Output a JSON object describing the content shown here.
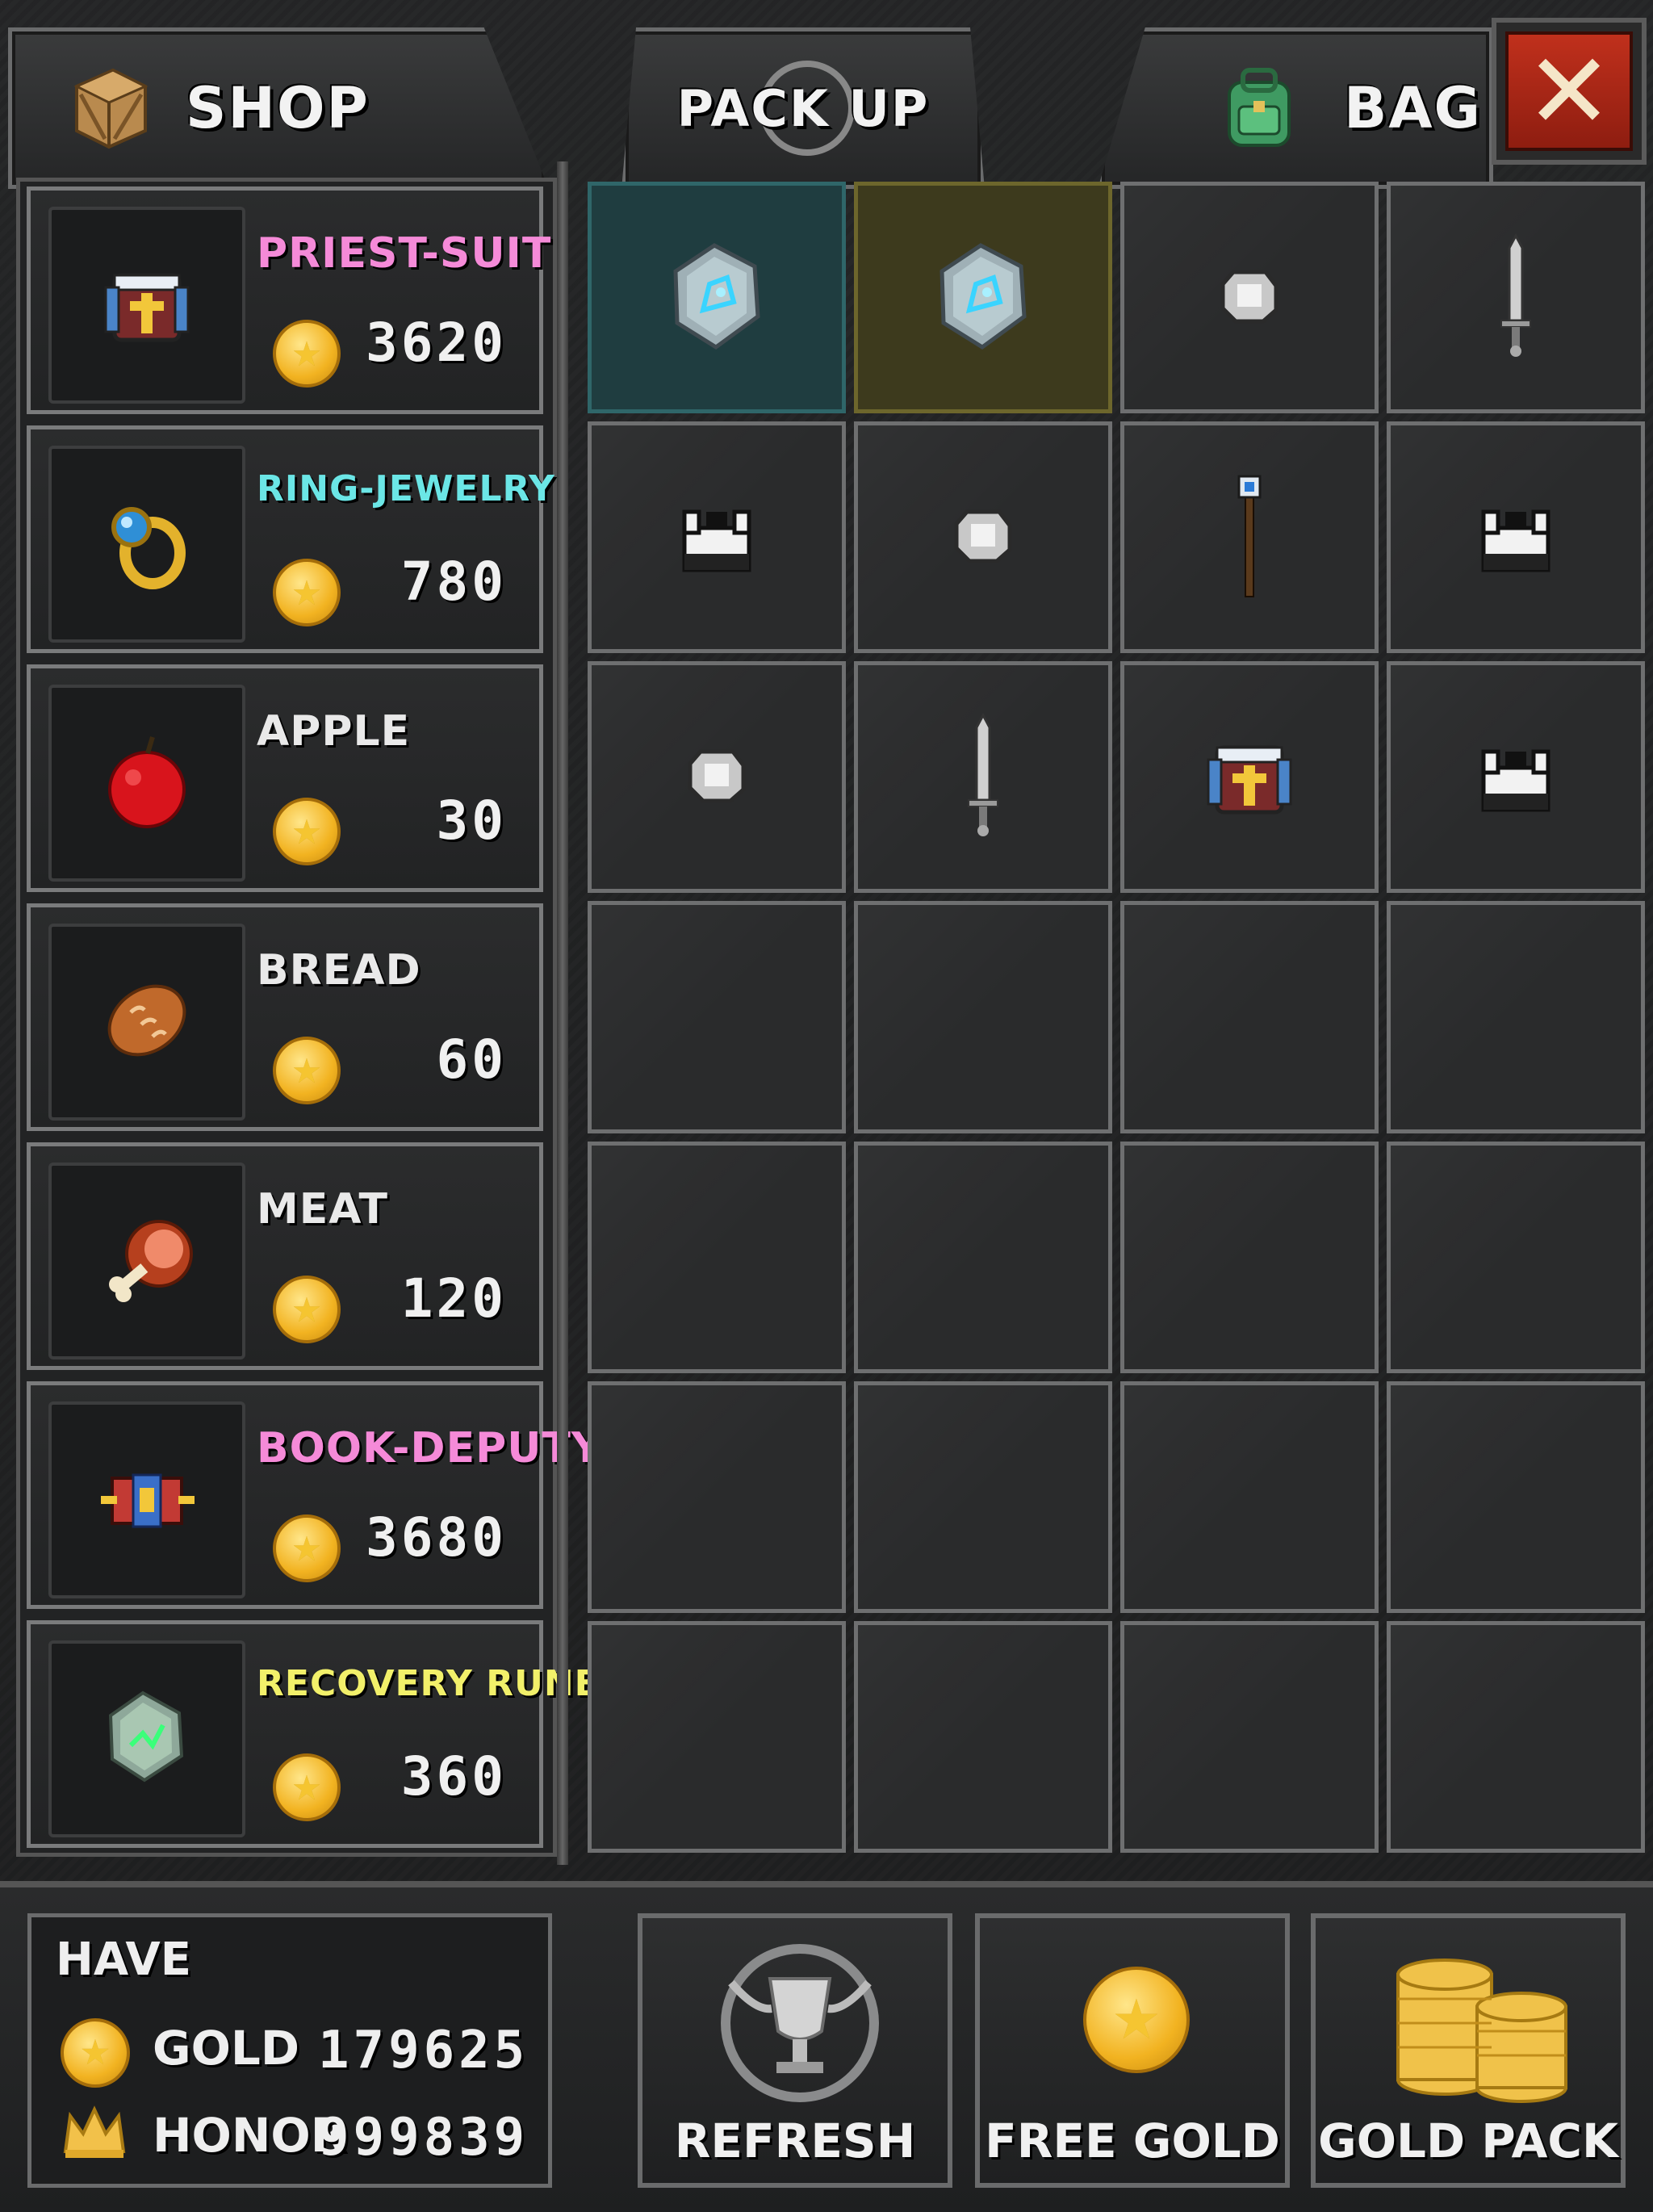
{
  "tabs": {
    "shop": "SHOP",
    "pack_up": "PACK UP",
    "bag": "BAG",
    "close": "✕"
  },
  "shop_items": [
    {
      "name": "PRIEST-SUIT",
      "price": "3620",
      "color": "#f58ad8",
      "icon": "priest-suit-icon"
    },
    {
      "name": "RING-JEWELRY",
      "price": "780",
      "color": "#6be6e6",
      "icon": "ring-icon"
    },
    {
      "name": "APPLE",
      "price": "30",
      "color": "#e9e9e9",
      "icon": "apple-icon"
    },
    {
      "name": "BREAD",
      "price": "60",
      "color": "#e9e9e9",
      "icon": "bread-icon"
    },
    {
      "name": "MEAT",
      "price": "120",
      "color": "#e9e9e9",
      "icon": "meat-icon"
    },
    {
      "name": "BOOK-DEPUTY",
      "price": "3680",
      "color": "#f58ad8",
      "icon": "book-icon"
    },
    {
      "name": "RECOVERY RUNE",
      "price": "360",
      "color": "#f2f06a",
      "icon": "recovery-rune-icon"
    }
  ],
  "bag_slots": [
    {
      "icon": "blue-rune-icon",
      "highlight": "teal"
    },
    {
      "icon": "blue-rune-icon",
      "highlight": "yellow"
    },
    {
      "icon": "silver-ore-icon"
    },
    {
      "icon": "sword-icon"
    },
    {
      "icon": "armor-icon"
    },
    {
      "icon": "silver-ore-icon"
    },
    {
      "icon": "staff-icon"
    },
    {
      "icon": "armor-icon"
    },
    {
      "icon": "silver-ore-icon"
    },
    {
      "icon": "sword-icon"
    },
    {
      "icon": "priest-suit-icon"
    },
    {
      "icon": "armor-icon"
    },
    {
      "icon": ""
    },
    {
      "icon": ""
    },
    {
      "icon": ""
    },
    {
      "icon": ""
    },
    {
      "icon": ""
    },
    {
      "icon": ""
    },
    {
      "icon": ""
    },
    {
      "icon": ""
    },
    {
      "icon": ""
    },
    {
      "icon": ""
    },
    {
      "icon": ""
    },
    {
      "icon": ""
    },
    {
      "icon": ""
    },
    {
      "icon": ""
    },
    {
      "icon": ""
    },
    {
      "icon": ""
    }
  ],
  "have": {
    "title": "HAVE",
    "gold_label": "GOLD",
    "gold_value": "179625",
    "honor_label": "HONOR",
    "honor_value": "999839"
  },
  "actions": {
    "refresh": "REFRESH",
    "free_gold": "FREE GOLD",
    "gold_pack": "GOLD PACK"
  },
  "colors": {
    "pink_rarity": "#f58ad8",
    "cyan_rarity": "#6be6e6",
    "yellow_rarity": "#f2f06a",
    "close_red": "#b12a17"
  }
}
